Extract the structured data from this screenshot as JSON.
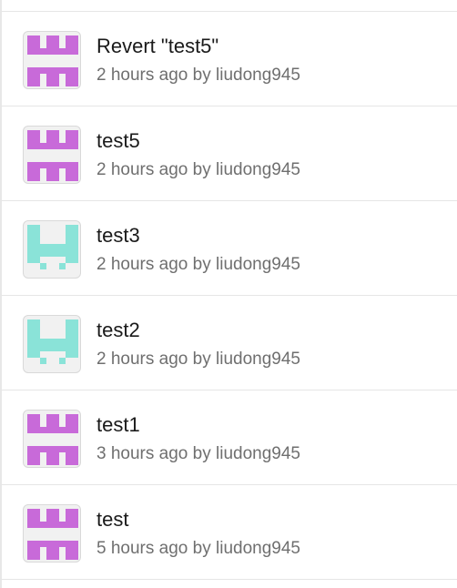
{
  "commits": [
    {
      "title": "Revert \"test5\"",
      "time": "2 hours ago",
      "by": "by",
      "author": "liudong945",
      "avatar_pattern": "pattern-a",
      "avatar_color": "#c86ad9"
    },
    {
      "title": "test5",
      "time": "2 hours ago",
      "by": "by",
      "author": "liudong945",
      "avatar_pattern": "pattern-a",
      "avatar_color": "#c86ad9"
    },
    {
      "title": "test3",
      "time": "2 hours ago",
      "by": "by",
      "author": "liudong945",
      "avatar_pattern": "pattern-b",
      "avatar_color": "#8ae3d8"
    },
    {
      "title": "test2",
      "time": "2 hours ago",
      "by": "by",
      "author": "liudong945",
      "avatar_pattern": "pattern-b",
      "avatar_color": "#8ae3d8"
    },
    {
      "title": "test1",
      "time": "3 hours ago",
      "by": "by",
      "author": "liudong945",
      "avatar_pattern": "pattern-a",
      "avatar_color": "#c86ad9"
    },
    {
      "title": "test",
      "time": "5 hours ago",
      "by": "by",
      "author": "liudong945",
      "avatar_pattern": "pattern-a",
      "avatar_color": "#c86ad9"
    }
  ]
}
